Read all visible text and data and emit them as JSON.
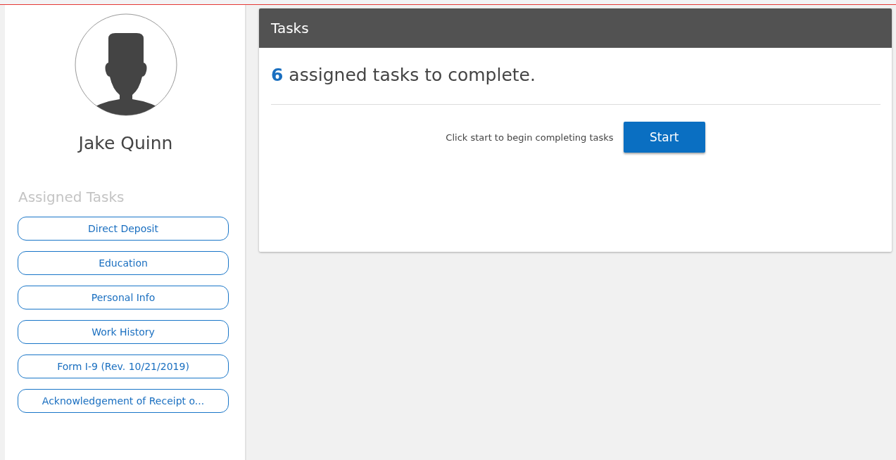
{
  "profile": {
    "name": "Jake Quinn"
  },
  "sidebar": {
    "heading": "Assigned Tasks",
    "items": [
      {
        "label": "Direct Deposit"
      },
      {
        "label": "Education"
      },
      {
        "label": "Personal Info"
      },
      {
        "label": "Work History"
      },
      {
        "label": "Form I-9 (Rev. 10/21/2019)"
      },
      {
        "label": "Acknowledgement of Receipt o..."
      }
    ]
  },
  "panel": {
    "title": "Tasks",
    "count": "6",
    "summary": "assigned tasks to complete.",
    "hint": "Click start to begin completing tasks",
    "button": "Start"
  }
}
